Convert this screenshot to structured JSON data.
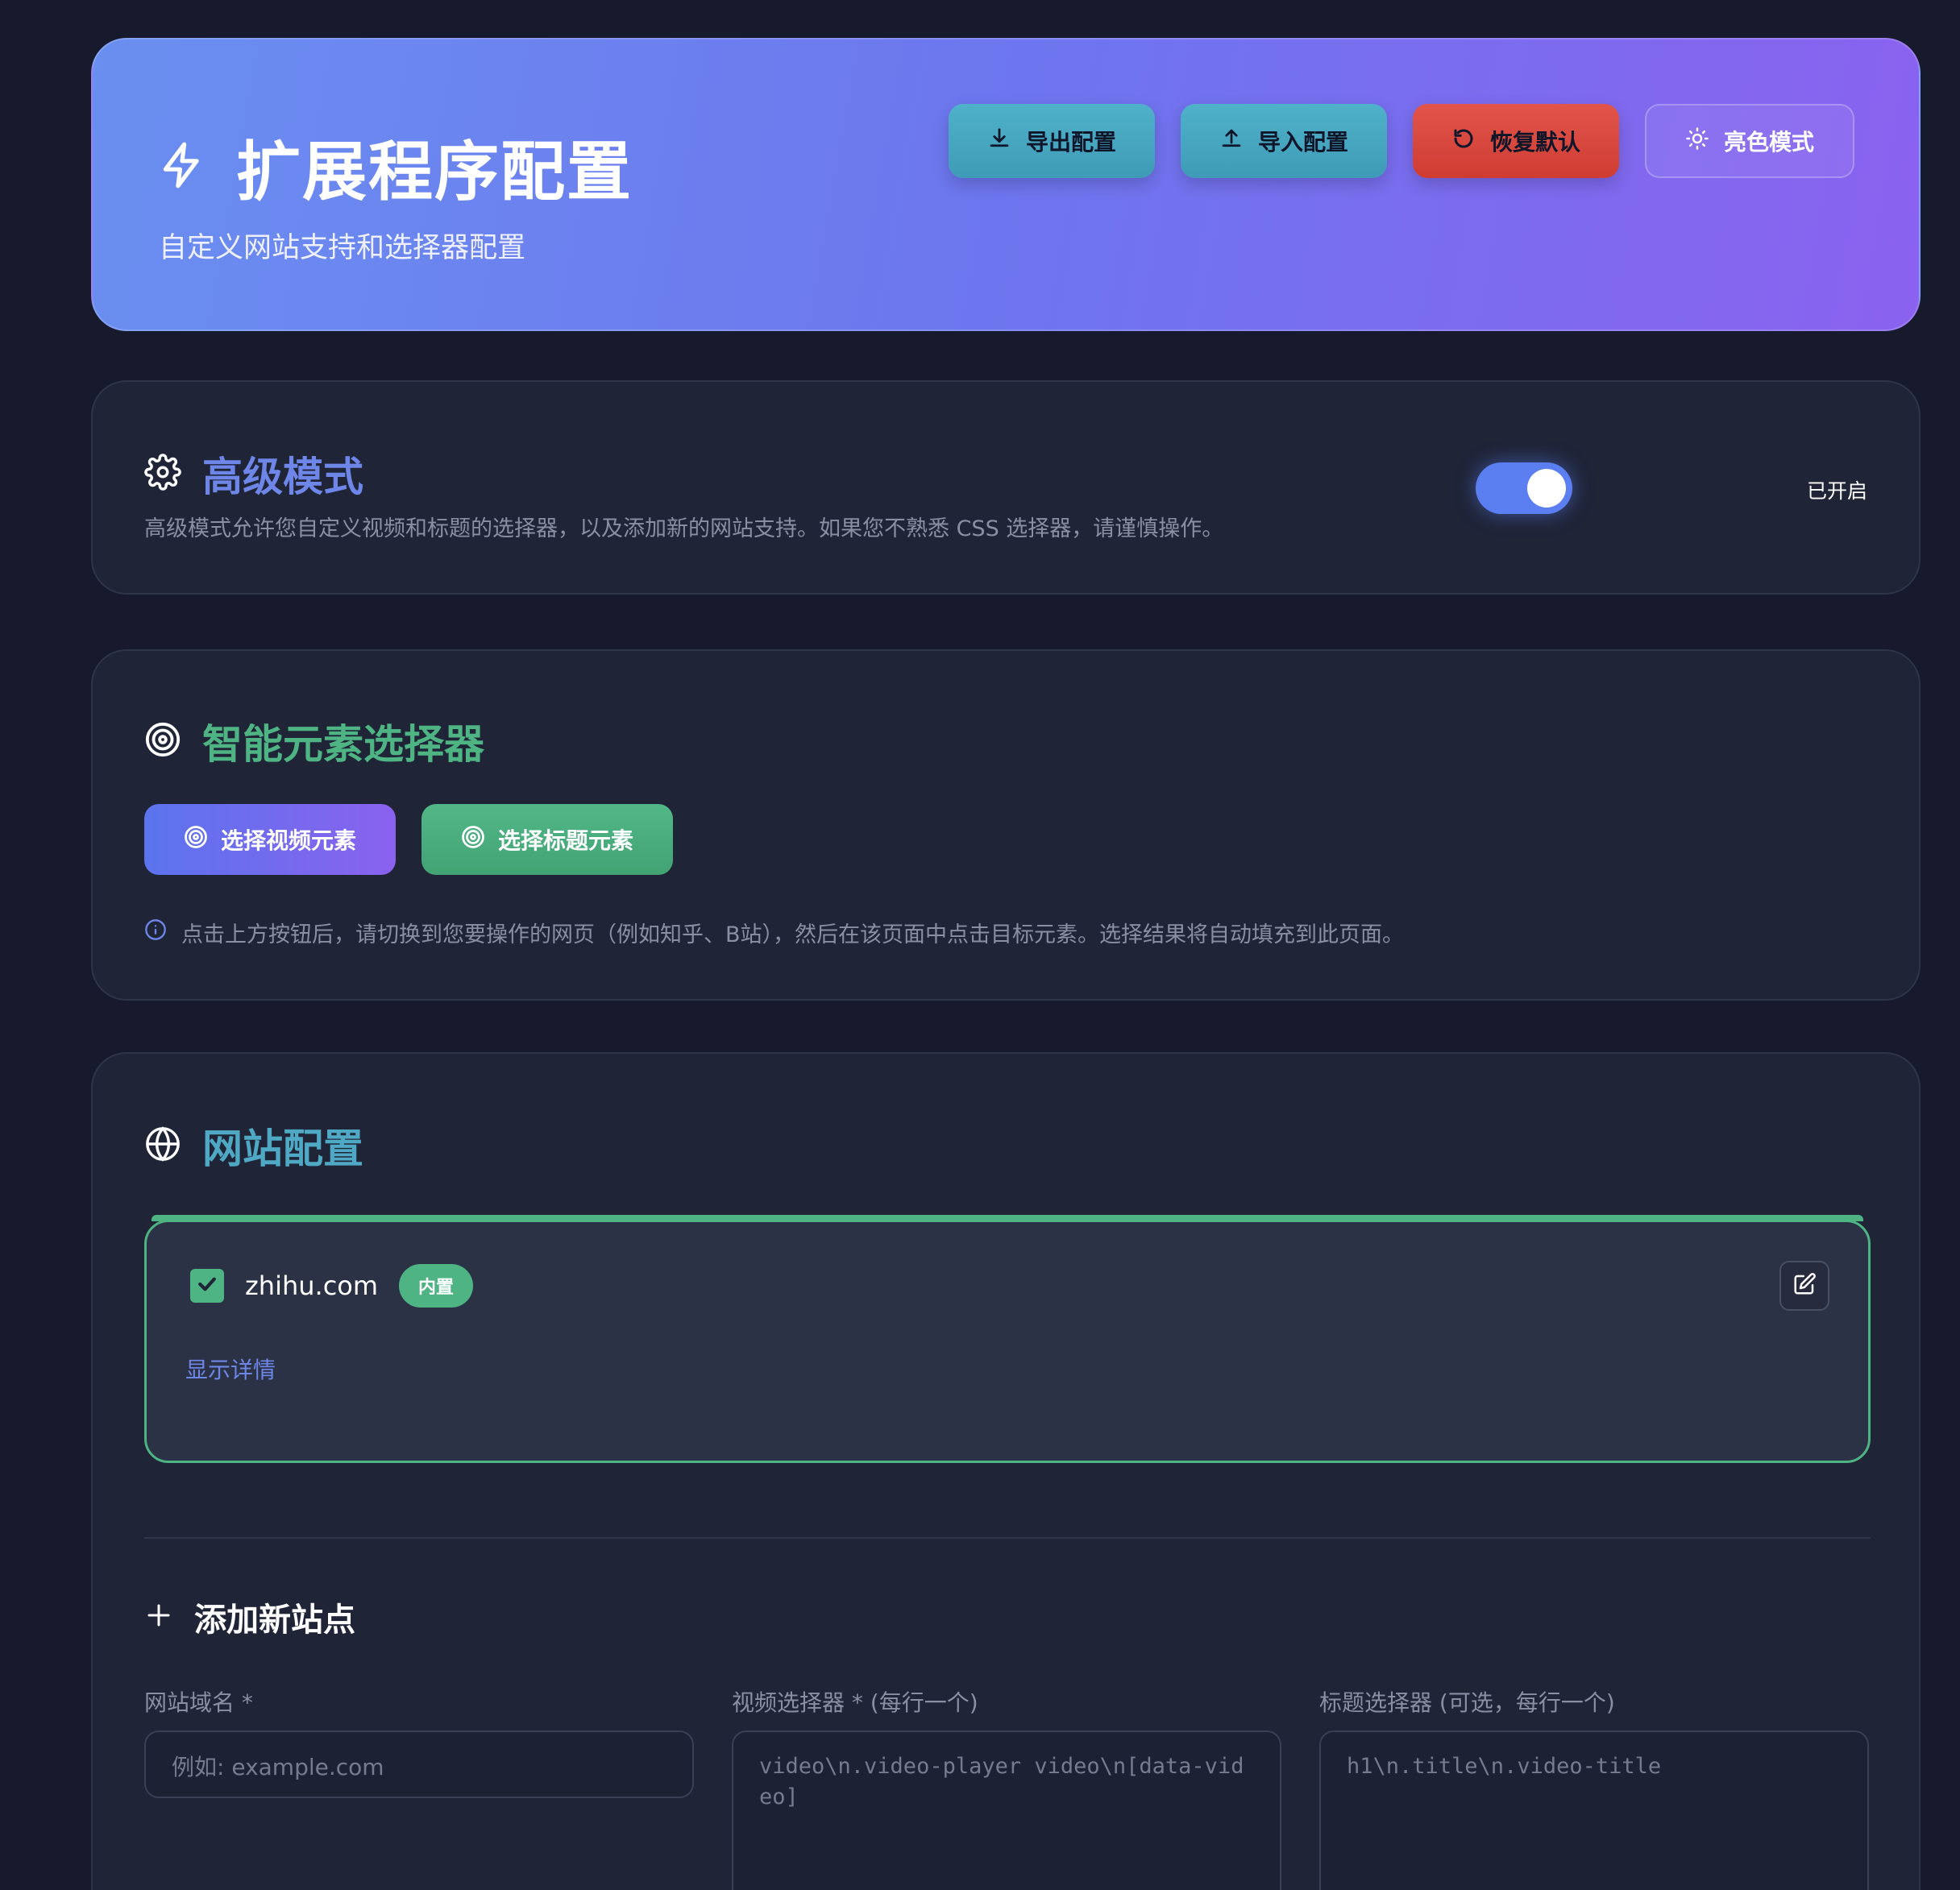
{
  "header": {
    "title": "扩展程序配置",
    "subtitle": "自定义网站支持和选择器配置",
    "buttons": {
      "export": "导出配置",
      "import": "导入配置",
      "reset": "恢复默认",
      "theme": "亮色模式"
    }
  },
  "advanced": {
    "title": "高级模式",
    "description": "高级模式允许您自定义视频和标题的选择器，以及添加新的网站支持。如果您不熟悉 CSS 选择器，请谨慎操作。",
    "enabled": true,
    "status": "已开启"
  },
  "picker": {
    "title": "智能元素选择器",
    "video_button": "选择视频元素",
    "title_button": "选择标题元素",
    "hint": "点击上方按钮后，请切换到您要操作的网页（例如知乎、B站），然后在该页面中点击目标元素。选择结果将自动填充到此页面。"
  },
  "sites": {
    "title": "网站配置",
    "items": [
      {
        "domain": "zhihu.com",
        "badge": "内置",
        "checked": true,
        "details_link": "显示详情"
      }
    ],
    "add": {
      "title": "添加新站点",
      "domain_label": "网站域名 *",
      "domain_placeholder": "例如: example.com",
      "video_label": "视频选择器 * (每行一个)",
      "video_placeholder": "video\\n.video-player video\\n[data-video]",
      "title_label": "标题选择器 (可选，每行一个)",
      "title_placeholder": "h1\\n.title\\n.video-title"
    }
  },
  "colors": {
    "accent_blue": "#6e86e8",
    "accent_green": "#4fb483",
    "accent_teal": "#4fa9c4",
    "danger": "#e2554b"
  }
}
